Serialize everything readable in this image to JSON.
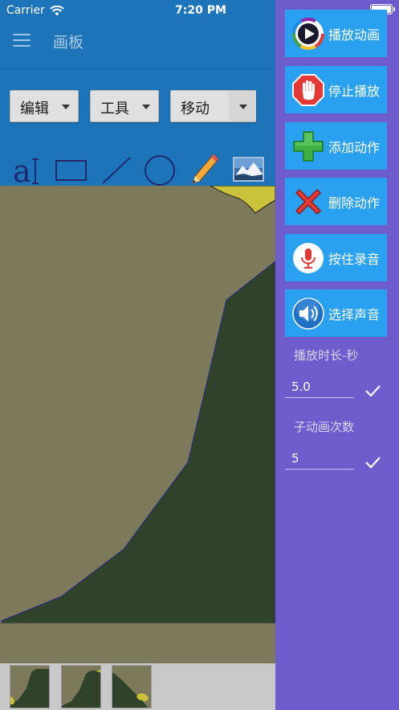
{
  "status_bar": {
    "carrier": "Carrier",
    "time": "7:20 PM"
  },
  "header": {
    "title": "画板"
  },
  "dropdowns": {
    "edit": "编辑",
    "tools": "工具",
    "mode": "移动"
  },
  "tools": [
    "text-tool",
    "rectangle-tool",
    "line-tool",
    "circle-tool",
    "pencil-tool",
    "image-tool"
  ],
  "drawer": {
    "buttons": [
      {
        "label": "播放动画",
        "icon": "play-icon"
      },
      {
        "label": "停止播放",
        "icon": "stop-hand-icon"
      },
      {
        "label": "添加动作",
        "icon": "plus-icon"
      },
      {
        "label": "删除动作",
        "icon": "delete-x-icon"
      },
      {
        "label": "按住录音",
        "icon": "microphone-icon"
      },
      {
        "label": "选择声音",
        "icon": "speaker-icon"
      }
    ],
    "duration_label": "播放时长-秒",
    "duration_value": "5.0",
    "sub_anim_label": "子动画次数",
    "sub_anim_value": "5"
  },
  "colors": {
    "header_blue": "#1e74b8",
    "canvas_bg": "#7c7a5a",
    "mountain": "#2e432a",
    "drawer_bg": "#6e5ccd",
    "button_blue": "#29a0f0",
    "yellow_shape": "#c9c23a"
  },
  "thumbnails_count": 3
}
